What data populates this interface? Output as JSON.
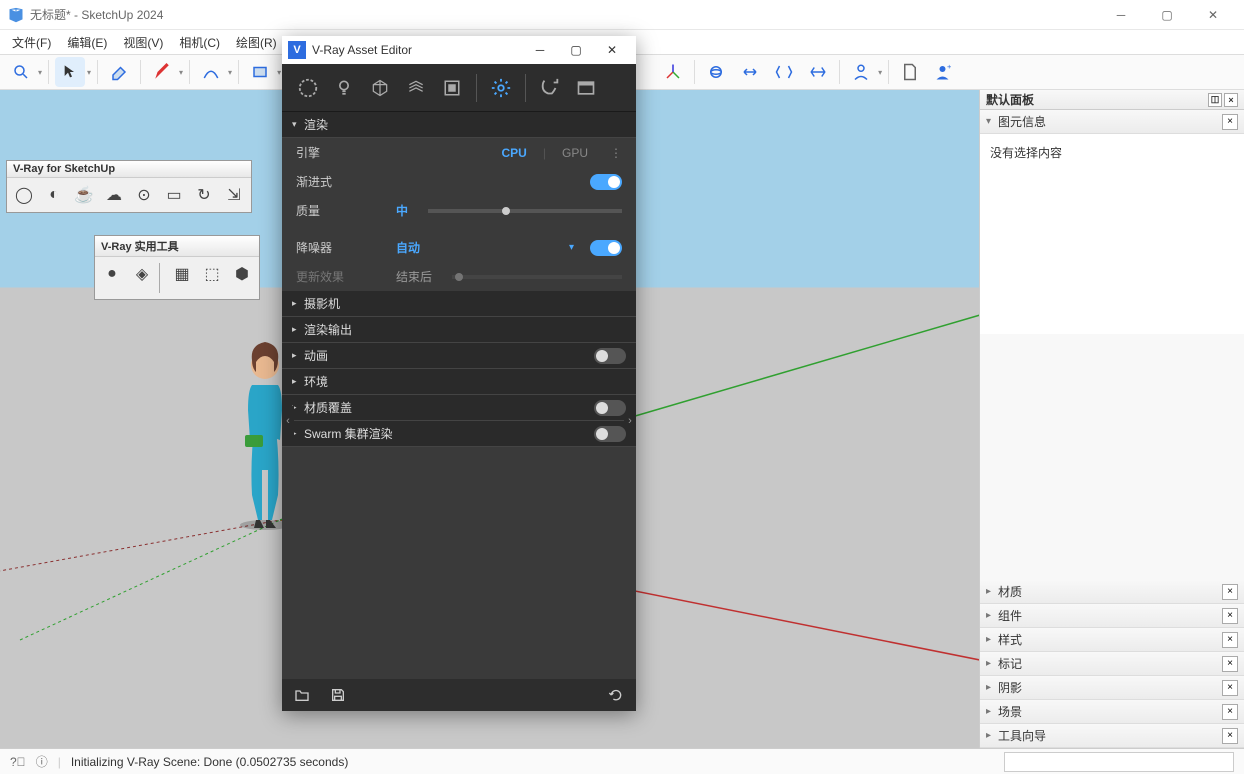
{
  "window": {
    "title": "无标题* - SketchUp 2024"
  },
  "menu": [
    "文件(F)",
    "编辑(E)",
    "视图(V)",
    "相机(C)",
    "绘图(R)"
  ],
  "float_toolbars": {
    "vraymain": {
      "title": "V-Ray for SketchUp"
    },
    "vrayutil": {
      "title": "V-Ray 实用工具"
    },
    "unnamed": {
      "title": ""
    }
  },
  "tray": {
    "title": "默认面板",
    "entity_info": {
      "title": "图元信息",
      "content": "没有选择内容",
      "expanded": true
    },
    "panels": [
      {
        "title": "材质"
      },
      {
        "title": "组件"
      },
      {
        "title": "样式"
      },
      {
        "title": "标记"
      },
      {
        "title": "阴影"
      },
      {
        "title": "场景"
      },
      {
        "title": "工具向导"
      }
    ]
  },
  "statusbar": {
    "message": "Initializing V-Ray Scene: Done (0.0502735 seconds)"
  },
  "vray": {
    "title": "V-Ray Asset Editor",
    "settings": {
      "render": {
        "title": "渲染",
        "engine_label": "引擎",
        "engine_options": [
          "CPU",
          "GPU"
        ],
        "engine_active": "CPU",
        "progressive_label": "渐进式",
        "progressive": true,
        "quality_label": "质量",
        "quality_value": "中",
        "denoiser_label": "降噪器",
        "denoiser_value": "自动",
        "denoiser_on": true,
        "update_label": "更新效果",
        "update_value": "结束后"
      },
      "sections": [
        {
          "title": "摄影机",
          "toggle": null
        },
        {
          "title": "渲染输出",
          "toggle": null
        },
        {
          "title": "动画",
          "toggle": false
        },
        {
          "title": "环境",
          "toggle": null
        },
        {
          "title": "材质覆盖",
          "toggle": false
        },
        {
          "title": "Swarm 集群渲染",
          "toggle": false
        }
      ]
    }
  }
}
